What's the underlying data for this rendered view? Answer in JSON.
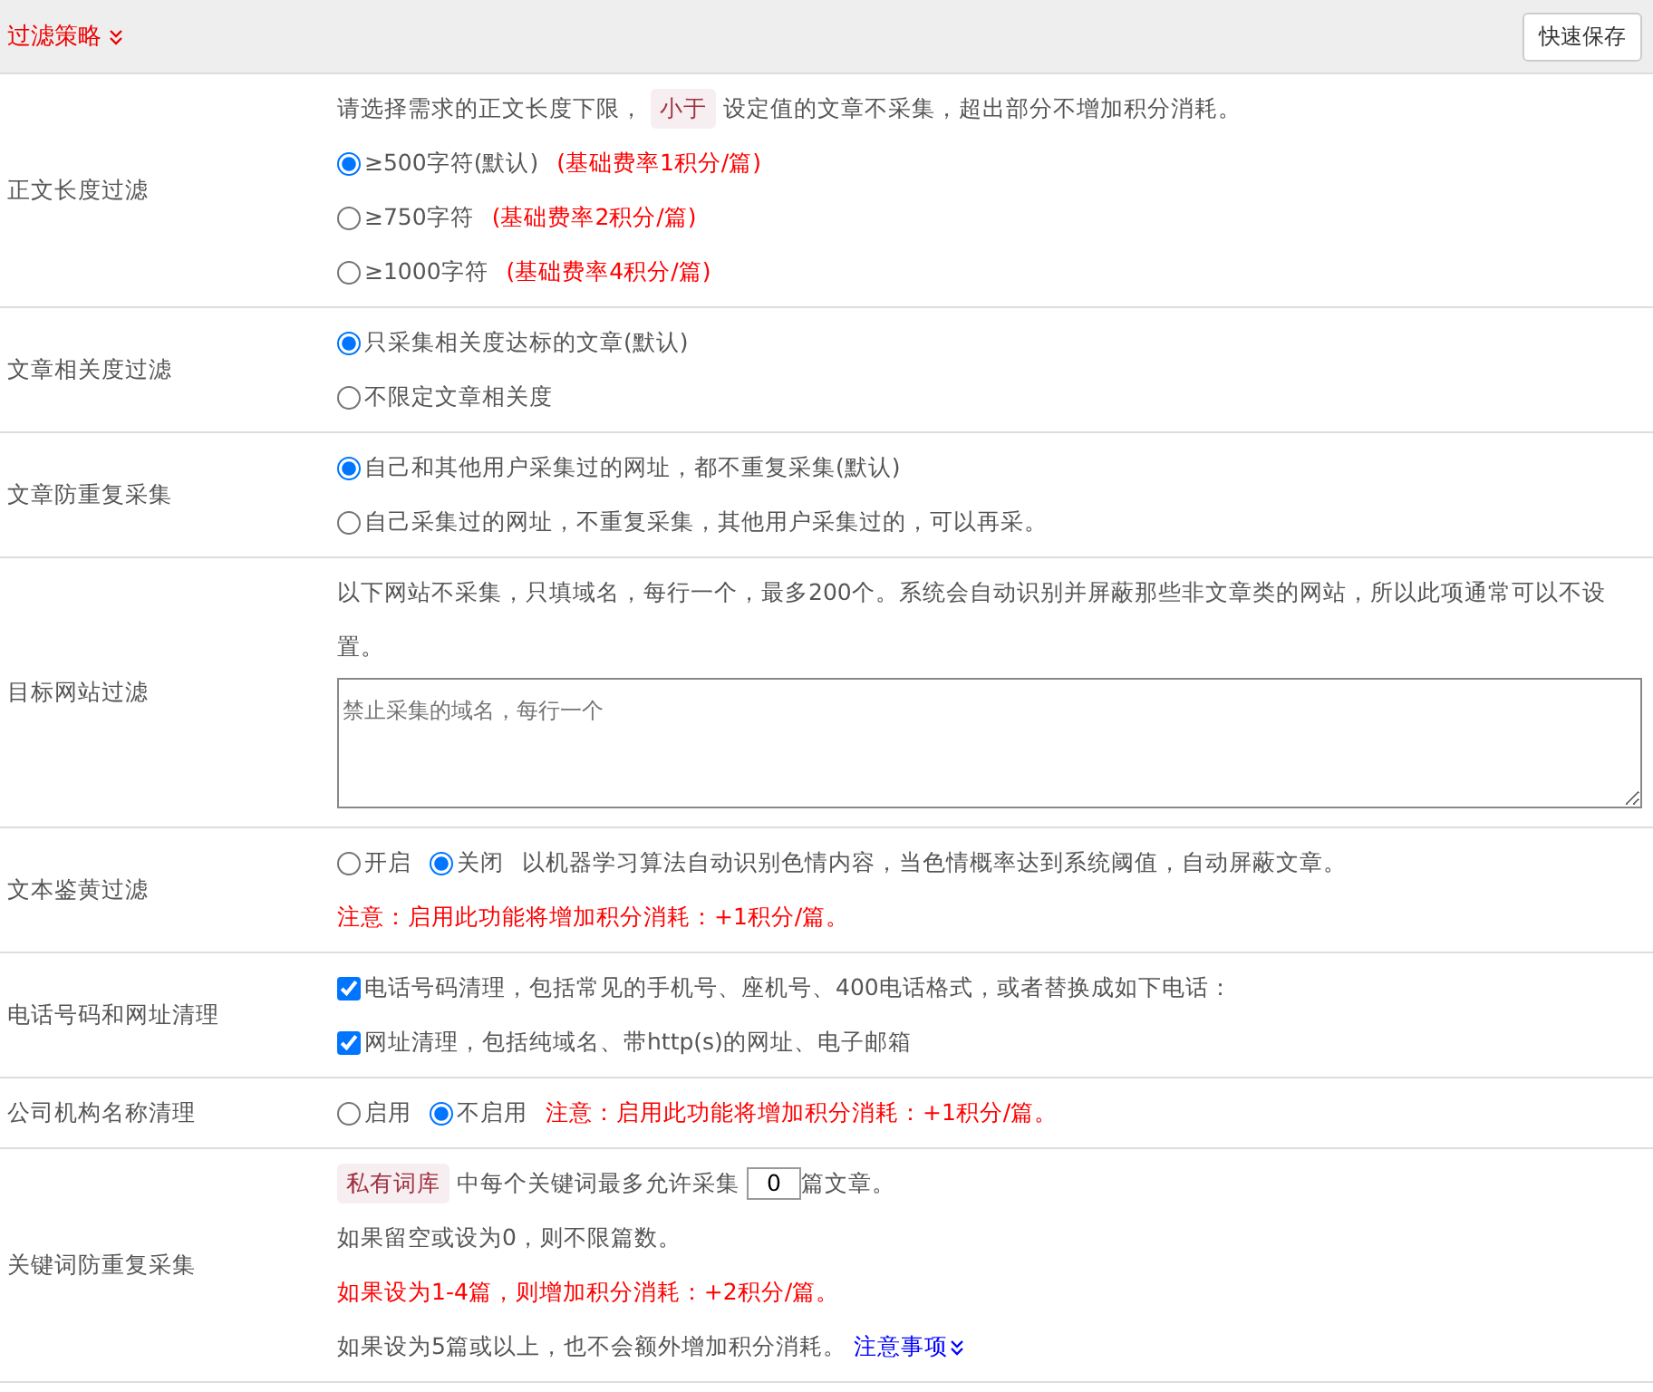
{
  "header": {
    "title": "过滤策略",
    "save_button": "快速保存"
  },
  "rows": [
    {
      "label": "正文长度过滤",
      "lines": [
        [
          {
            "kind": "text",
            "text": "请选择需求的正文长度下限，"
          },
          {
            "kind": "tag",
            "text": "小于"
          },
          {
            "kind": "text",
            "text": "设定值的文章不采集，超出部分不增加积分消耗。"
          }
        ],
        [
          {
            "kind": "radio",
            "text": "≥500字符(默认)",
            "selected": true
          },
          {
            "kind": "note",
            "text": "(基础费率1积分/篇)"
          }
        ],
        [
          {
            "kind": "radio",
            "text": "≥750字符",
            "selected": false
          },
          {
            "kind": "note",
            "text": "(基础费率2积分/篇)"
          }
        ],
        [
          {
            "kind": "radio",
            "text": "≥1000字符",
            "selected": false
          },
          {
            "kind": "note",
            "text": "(基础费率4积分/篇)"
          }
        ]
      ]
    },
    {
      "label": "文章相关度过滤",
      "lines": [
        [
          {
            "kind": "radio",
            "text": "只采集相关度达标的文章(默认)",
            "selected": true
          }
        ],
        [
          {
            "kind": "radio",
            "text": "不限定文章相关度",
            "selected": false
          }
        ]
      ]
    },
    {
      "label": "文章防重复采集",
      "lines": [
        [
          {
            "kind": "radio",
            "text": "自己和其他用户采集过的网址，都不重复采集(默认)",
            "selected": true
          }
        ],
        [
          {
            "kind": "radio",
            "text": "自己采集过的网址，不重复采集，其他用户采集过的，可以再采。",
            "selected": false
          }
        ]
      ]
    },
    {
      "label": "目标网站过滤",
      "lines": [
        [
          {
            "kind": "text",
            "text": "以下网站不采集，只填域名，每行一个，最多200个。系统会自动识别并屏蔽那些非文章类的网站，所以此项通常可以不设置。"
          }
        ],
        [
          {
            "kind": "textarea",
            "placeholder": "禁止采集的域名，每行一个"
          }
        ]
      ]
    },
    {
      "label": "文本鉴黄过滤",
      "lines": [
        [
          {
            "kind": "radio",
            "text": "开启",
            "selected": false
          },
          {
            "kind": "radio",
            "text": "关闭",
            "selected": true
          },
          {
            "kind": "text",
            "text": "以机器学习算法自动识别色情内容，当色情概率达到系统阈值，自动屏蔽文章。"
          }
        ],
        [
          {
            "kind": "note",
            "text": "注意：启用此功能将增加积分消耗：+1积分/篇。"
          }
        ]
      ]
    },
    {
      "label": "电话号码和网址清理",
      "lines": [
        [
          {
            "kind": "checkbox",
            "text": "电话号码清理，包括常见的手机号、座机号、400电话格式，或者替换成如下电话：",
            "checked": true
          }
        ],
        [
          {
            "kind": "checkbox",
            "text": "网址清理，包括纯域名、带http(s)的网址、电子邮箱",
            "checked": true
          }
        ]
      ]
    },
    {
      "label": "公司机构名称清理",
      "lines": [
        [
          {
            "kind": "radio",
            "text": "启用",
            "selected": false
          },
          {
            "kind": "radio",
            "text": "不启用",
            "selected": true
          },
          {
            "kind": "note",
            "text": "注意：启用此功能将增加积分消耗：+1积分/篇。"
          }
        ]
      ]
    },
    {
      "label": "关键词防重复采集",
      "lines": [
        [
          {
            "kind": "tag",
            "text": "私有词库"
          },
          {
            "kind": "text",
            "text": "中每个关键词最多允许采集"
          },
          {
            "kind": "input",
            "value": "0"
          },
          {
            "kind": "text",
            "text": "篇文章。"
          }
        ],
        [
          {
            "kind": "text",
            "text": "如果留空或设为0，则不限篇数。"
          }
        ],
        [
          {
            "kind": "note",
            "text": "如果设为1-4篇，则增加积分消耗：+2积分/篇。"
          }
        ],
        [
          {
            "kind": "text",
            "text": "如果设为5篇或以上，也不会额外增加积分消耗。"
          },
          {
            "kind": "link",
            "text": "注意事项"
          }
        ]
      ]
    }
  ]
}
